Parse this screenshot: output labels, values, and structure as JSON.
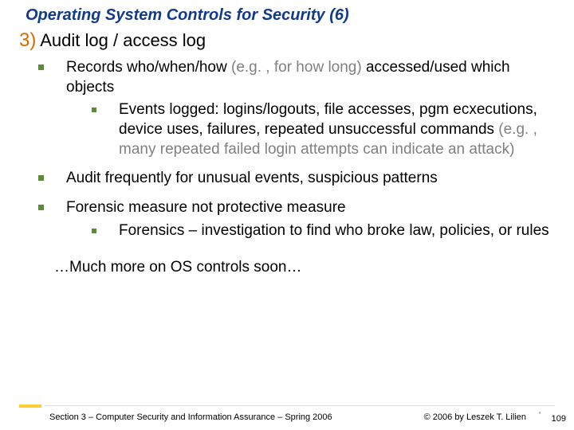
{
  "title": "Operating System Controls for Security (6)",
  "heading": {
    "num": "3)",
    "text": "Audit log / access log"
  },
  "bullets": [
    {
      "lead": "Records who/when/how",
      "lead_gray": " (e.g. , for how long)",
      "cont": " accessed/used which objects",
      "sub": {
        "lead": "Events logged: logins/logouts, file accesses, pgm ecxecutions, device uses, failures, repeated unsuccessful commands",
        "gray": " (e.g. , many repeated failed login attempts can indicate an attack)"
      }
    },
    {
      "plain": "Audit frequently for unusual events, suspicious patterns"
    },
    {
      "lead": "Forensic measure not protective measure",
      "sub2": "Forensics – investigation to find who broke law, policies, or rules"
    }
  ],
  "closing": "…Much more on OS controls soon…",
  "footer": {
    "left": "Section 3 – Computer Security and Information Assurance – Spring 2006",
    "right": "© 2006 by Leszek T. Lilien",
    "page": "109",
    "tick": "'"
  }
}
